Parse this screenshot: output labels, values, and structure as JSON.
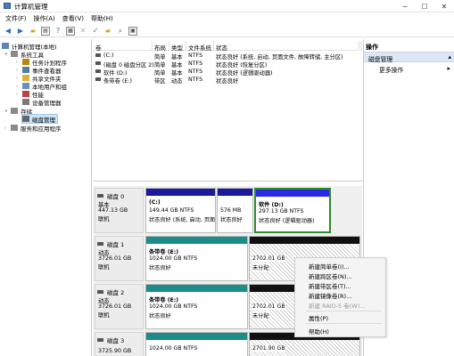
{
  "window": {
    "title": "计算机管理",
    "controls": [
      "─",
      "☐",
      "✕"
    ]
  },
  "menu": [
    "文件(F)",
    "操作(A)",
    "查看(V)",
    "帮助(H)"
  ],
  "tree": {
    "root": "计算机管理(本地)",
    "system_tools": "系统工具",
    "task_scheduler": "任务计划程序",
    "event_viewer": "事件查看器",
    "shared_folders": "共享文件夹",
    "local_users": "本地用户和组",
    "performance": "性能",
    "device_manager": "设备管理器",
    "storage": "存储",
    "disk_management": "磁盘管理",
    "services_apps": "服务和应用程序"
  },
  "volume_table": {
    "columns": [
      "卷",
      "布局",
      "类型",
      "文件系统",
      "状态"
    ],
    "rows": [
      {
        "vol": "(C:)",
        "layout": "简单",
        "type": "基本",
        "fs": "NTFS",
        "status": "状态良好 (系统, 启动, 页面文件, 故障转储, 主分区)"
      },
      {
        "vol": "(磁盘 0 磁盘分区 2)",
        "layout": "简单",
        "type": "基本",
        "fs": "NTFS",
        "status": "状态良好 (恢复分区)"
      },
      {
        "vol": "软件 (D:)",
        "layout": "简单",
        "type": "基本",
        "fs": "NTFS",
        "status": "状态良好 (逻辑驱动器)"
      },
      {
        "vol": "条带卷 (E:)",
        "layout": "带区",
        "type": "动态",
        "fs": "NTFS",
        "status": "状态良好"
      }
    ]
  },
  "actions": {
    "title": "操作",
    "section": "磁盘管理",
    "more": "更多操作"
  },
  "disks": [
    {
      "name": "磁盘 0",
      "type": "基本",
      "size": "447.13 GB",
      "state": "联机",
      "parts": [
        {
          "title": "(C:)",
          "line2": "149.44 GB NTFS",
          "line3": "状态良好 (系统, 启动, 页面"
        },
        {
          "title": "",
          "line2": "576 MB",
          "line3": "状态良好"
        },
        {
          "title": "软件 (D:)",
          "line2": "297.13 GB NTFS",
          "line3": "状态良好 (逻辑驱动器)"
        }
      ]
    },
    {
      "name": "磁盘 1",
      "type": "动态",
      "size": "3726.01 GB",
      "state": "联机",
      "parts": [
        {
          "title": "条带卷 (E:)",
          "line2": "1024.00 GB NTFS",
          "line3": "状态良好"
        },
        {
          "title": "",
          "line2": "2702.01 GB",
          "line3": "未分配"
        }
      ]
    },
    {
      "name": "磁盘 2",
      "type": "动态",
      "size": "3726.01 GB",
      "state": "联机",
      "parts": [
        {
          "title": "条带卷 (E:)",
          "line2": "1024.00 GB NTFS",
          "line3": "状态良好"
        },
        {
          "title": "",
          "line2": "2702.01 GB",
          "line3": "未分配"
        }
      ]
    },
    {
      "name": "磁盘 3",
      "type": "",
      "size": "3725.90 GB",
      "state": "",
      "parts": [
        {
          "title": "",
          "line2": "1024.00 GB NTFS",
          "line3": ""
        },
        {
          "title": "",
          "line2": "2701.90 GB",
          "line3": ""
        }
      ]
    }
  ],
  "context_menu": {
    "items": [
      "新建简单卷(I)...",
      "新建跨区卷(N)...",
      "新建带区卷(T)...",
      "新建镜像卷(R)...",
      "新建 RAID-5 卷(W)...",
      "属性(P)",
      "帮助(H)"
    ]
  },
  "colors": {
    "primary_partition": "#1a1a9e",
    "dynamic_volume": "#1c8c8a",
    "unallocated": "#111111",
    "selection": "#2d8a2d"
  }
}
